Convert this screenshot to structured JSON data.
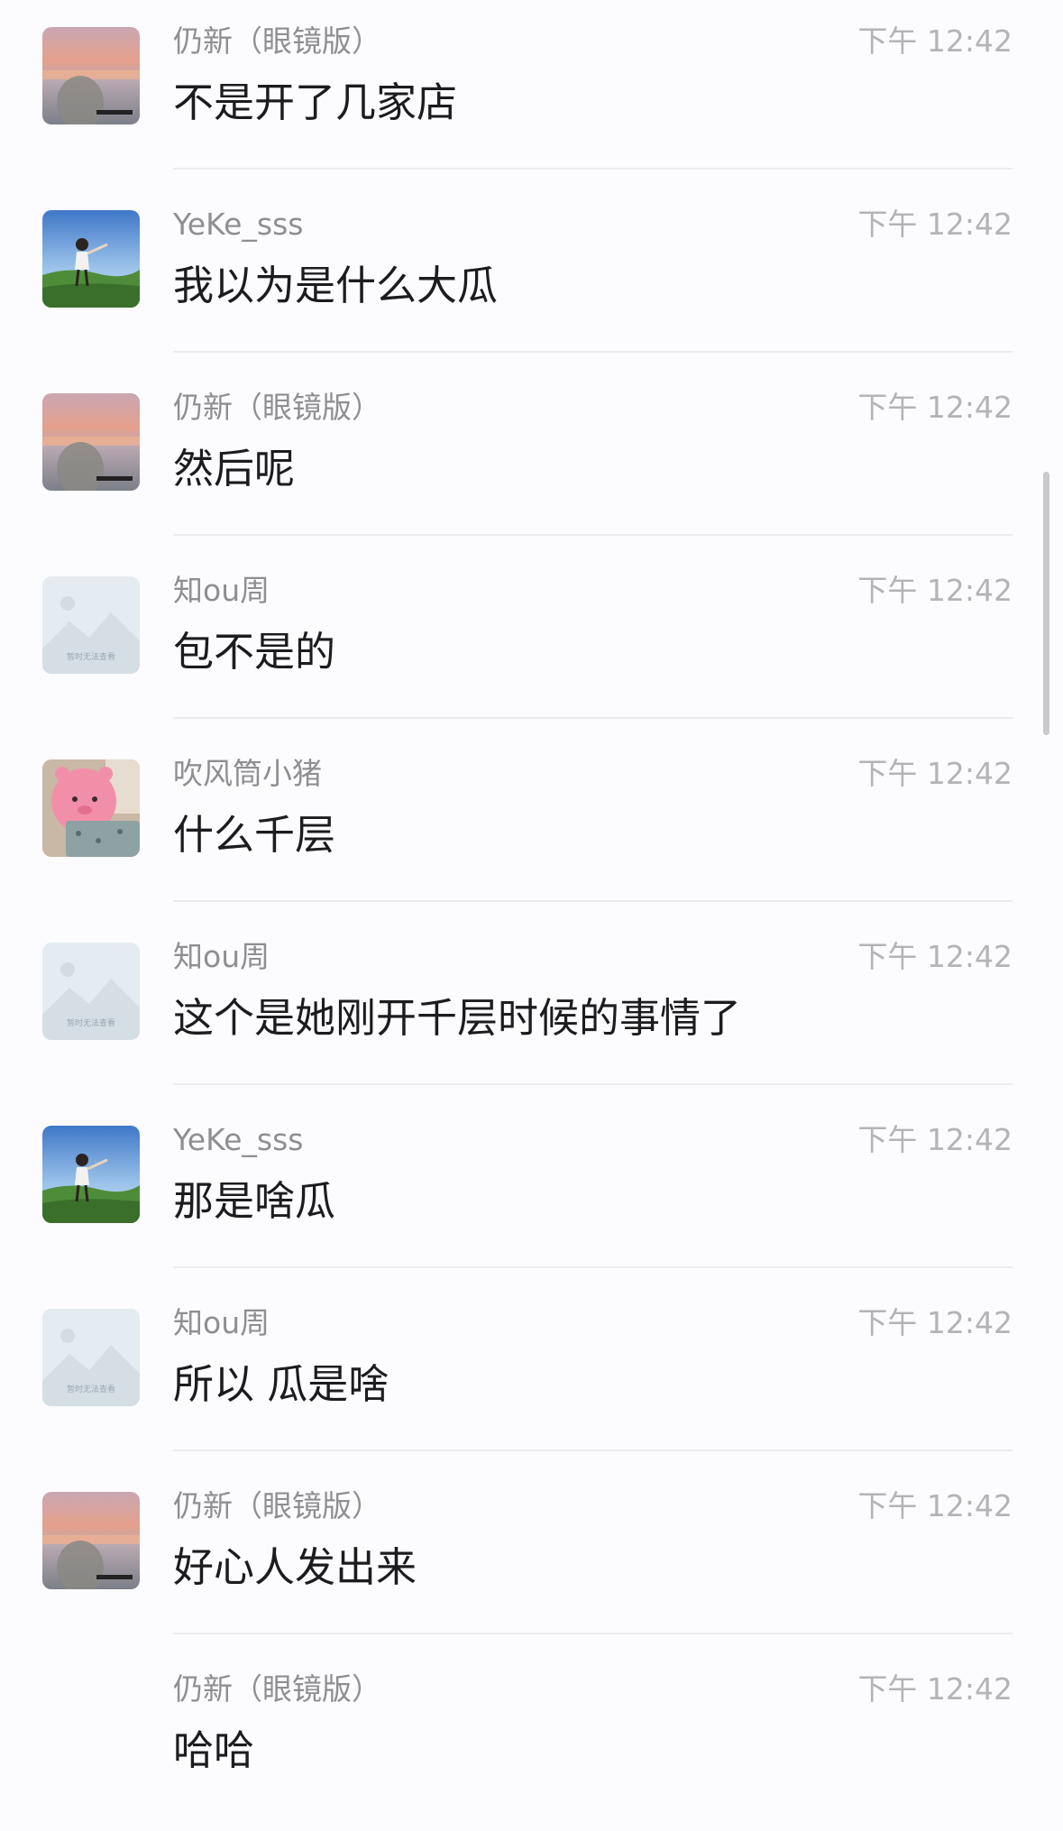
{
  "messages": [
    {
      "sender": "仍新（眼镜版）",
      "time": "下午 12:42",
      "text": "不是开了几家店",
      "avatar": "sunset-avatar"
    },
    {
      "sender": "YeKe_sss",
      "time": "下午 12:42",
      "text": "我以为是什么大瓜",
      "avatar": "girl-field-avatar"
    },
    {
      "sender": "仍新（眼镜版）",
      "time": "下午 12:42",
      "text": "然后呢",
      "avatar": "sunset-avatar"
    },
    {
      "sender": "知ou周",
      "time": "下午 12:42",
      "text": "包不是的",
      "avatar": "placeholder-avatar",
      "avatar_caption": "暂时无法查看"
    },
    {
      "sender": "吹风筒小猪",
      "time": "下午 12:42",
      "text": "什么千层",
      "avatar": "pink-pig-avatar"
    },
    {
      "sender": "知ou周",
      "time": "下午 12:42",
      "text": "这个是她刚开千层时候的事情了",
      "avatar": "placeholder-avatar",
      "avatar_caption": "暂时无法查看"
    },
    {
      "sender": "YeKe_sss",
      "time": "下午 12:42",
      "text": "那是啥瓜",
      "avatar": "girl-field-avatar"
    },
    {
      "sender": "知ou周",
      "time": "下午 12:42",
      "text": "所以 瓜是啥",
      "avatar": "placeholder-avatar",
      "avatar_caption": "暂时无法查看"
    },
    {
      "sender": "仍新（眼镜版）",
      "time": "下午 12:42",
      "text": "好心人发出来",
      "avatar": "sunset-avatar"
    },
    {
      "sender": "仍新（眼镜版）",
      "time": "下午 12:42",
      "text": "哈哈",
      "avatar": "none"
    }
  ],
  "colors": {
    "background": "#fcfbfd",
    "sender": "#8e8e93",
    "time": "#b3b3b8",
    "text": "#1c1c1e",
    "divider": "#ececf0"
  }
}
